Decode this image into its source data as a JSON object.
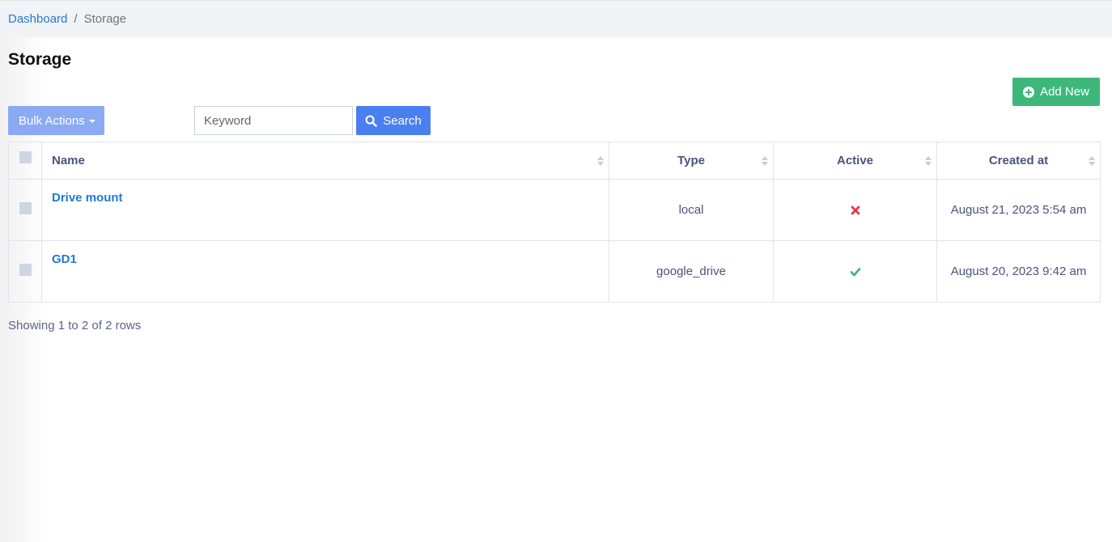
{
  "breadcrumb": {
    "home": "Dashboard",
    "separator": "/",
    "current": "Storage"
  },
  "page": {
    "title": "Storage"
  },
  "toolbar": {
    "add_new_label": "Add New",
    "bulk_actions_label": "Bulk Actions",
    "search_placeholder": "Keyword",
    "search_label": "Search"
  },
  "table": {
    "columns": {
      "name": "Name",
      "type": "Type",
      "active": "Active",
      "created_at": "Created at"
    },
    "rows": [
      {
        "name": "Drive mount",
        "type": "local",
        "active": false,
        "created_at": "August 21, 2023 5:54 am"
      },
      {
        "name": "GD1",
        "type": "google_drive",
        "active": true,
        "created_at": "August 20, 2023 9:42 am"
      }
    ]
  },
  "pagination": {
    "summary": "Showing 1 to 2 of 2 rows"
  },
  "colors": {
    "link": "#1f7ad6",
    "add_new": "#3db87a",
    "bulk_actions": "#8aaaf3",
    "search": "#4a7ff0",
    "active_true": "#3db87a",
    "active_false": "#e53945"
  }
}
